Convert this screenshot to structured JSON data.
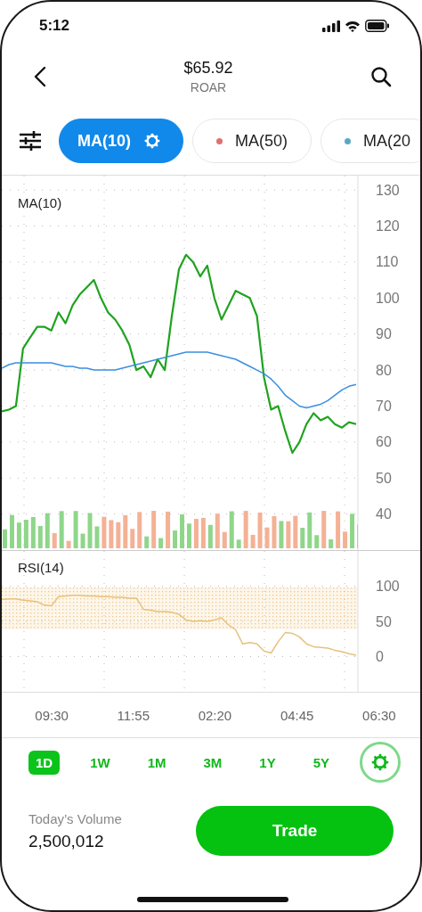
{
  "status_bar": {
    "time": "5:12"
  },
  "header": {
    "price": "$65.92",
    "ticker": "ROAR"
  },
  "indicators": [
    {
      "label": "MA(10)",
      "selected": true,
      "kind": "gear"
    },
    {
      "label": "MA(50)",
      "selected": false,
      "kind": "dot",
      "color": "#e07070"
    },
    {
      "label": "MA(20",
      "selected": false,
      "kind": "dot",
      "color": "#5aa8c0"
    }
  ],
  "price_panel": {
    "label": "MA(10)",
    "chart_data": {
      "type": "line",
      "categories": [
        null,
        null,
        null,
        null,
        null,
        null,
        null,
        null,
        null,
        null,
        null,
        null,
        null,
        null,
        null,
        null,
        null,
        null,
        null,
        null,
        null,
        null,
        null,
        null,
        null,
        null,
        null,
        null,
        null,
        null,
        null,
        null,
        null,
        null,
        null,
        null,
        null,
        null,
        null,
        null,
        null,
        null,
        null,
        null,
        null,
        null,
        null,
        null,
        null,
        null,
        null
      ],
      "ylim": [
        30,
        134
      ],
      "grid": true,
      "yticks": [
        40,
        50,
        60,
        70,
        80,
        90,
        100,
        110,
        120,
        130
      ],
      "series": [
        {
          "color": "#1fa31f",
          "values": [
            68.5,
            69,
            70,
            86,
            89,
            92,
            92,
            91,
            96,
            93,
            98,
            101,
            103,
            105,
            100,
            96,
            94,
            91,
            87,
            80,
            81,
            78,
            83,
            80,
            95,
            108,
            112,
            110,
            106,
            109,
            100,
            94,
            98,
            102,
            101,
            100,
            95,
            78,
            69,
            70,
            63,
            57,
            60,
            65,
            68,
            66,
            67,
            65,
            64,
            65.5,
            65
          ]
        },
        {
          "color": "#3a8fe0",
          "values": [
            80.5,
            81.5,
            82,
            82,
            82,
            82,
            82,
            82,
            81.5,
            81,
            81,
            80.5,
            80.5,
            80,
            80,
            80,
            80,
            80.5,
            81,
            81.5,
            82,
            82.5,
            83,
            83.5,
            84,
            84.5,
            85,
            85,
            85,
            85,
            84.5,
            84,
            83.5,
            83,
            82,
            81,
            80,
            79,
            77.5,
            75.5,
            73,
            71.5,
            70,
            69.5,
            70,
            70.5,
            71.5,
            73,
            74.5,
            75.5,
            76
          ]
        }
      ]
    }
  },
  "rsi_panel": {
    "label": "RSI(14)",
    "chart_data": {
      "type": "line",
      "categories": [
        null,
        null,
        null,
        null,
        null,
        null,
        null,
        null,
        null,
        null,
        null,
        null,
        null,
        null,
        null,
        null,
        null,
        null,
        null,
        null,
        null,
        null,
        null,
        null,
        null,
        null,
        null,
        null,
        null,
        null,
        null,
        null,
        null,
        null,
        null,
        null,
        null,
        null,
        null,
        null,
        null,
        null,
        null,
        null,
        null,
        null,
        null,
        null,
        null,
        null,
        null
      ],
      "ylim": [
        -50,
        150
      ],
      "grid": true,
      "yticks": [
        0,
        50,
        100
      ],
      "series": [
        {
          "color": "#e8c07a",
          "values": [
            81,
            82,
            82,
            80,
            79,
            78,
            73,
            72,
            85,
            86,
            87,
            87,
            86,
            86,
            85,
            85,
            84,
            84,
            83,
            83,
            67,
            66,
            64,
            64,
            63,
            60,
            52,
            50,
            51,
            50,
            52,
            55,
            45,
            38,
            18,
            20,
            18,
            8,
            5,
            21,
            34,
            33,
            28,
            18,
            14,
            13,
            12,
            9,
            7,
            4,
            2
          ]
        }
      ]
    }
  },
  "time_axis": [
    "09:30",
    "11:55",
    "02:20",
    "04:45",
    "06:30"
  ],
  "ranges": [
    {
      "label": "1D",
      "selected": true
    },
    {
      "label": "1W",
      "selected": false
    },
    {
      "label": "1M",
      "selected": false
    },
    {
      "label": "3M",
      "selected": false
    },
    {
      "label": "1Y",
      "selected": false
    },
    {
      "label": "5Y",
      "selected": false
    }
  ],
  "volume": {
    "label": "Today’s Volume",
    "value": "2,500,012"
  },
  "trade_button": "Trade"
}
